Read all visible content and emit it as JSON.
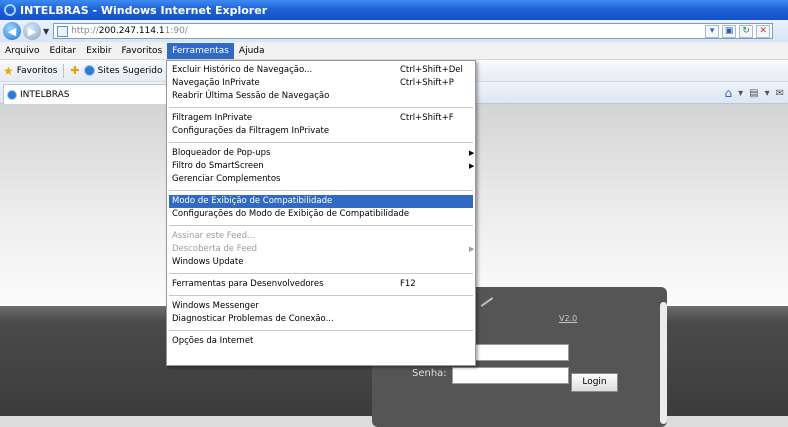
{
  "window": {
    "title": "INTELBRAS - Windows Internet Explorer"
  },
  "address": {
    "proto": "http://",
    "host": "200.247.114.1",
    "rest": "1:90/"
  },
  "menubar": {
    "items": [
      "Arquivo",
      "Editar",
      "Exibir",
      "Favoritos",
      "Ferramentas",
      "Ajuda"
    ],
    "active_index": 4
  },
  "favorites": {
    "label": "Favoritos",
    "suggested": "Sites Sugerido"
  },
  "tab": {
    "title": "INTELBRAS"
  },
  "login": {
    "version": "V2.0",
    "password_label": "Senha:",
    "login_button": "Login"
  },
  "tools_menu": {
    "items": [
      {
        "label": "Excluir Histórico de Navegação...",
        "shortcut": "Ctrl+Shift+Del"
      },
      {
        "label": "Navegação InPrivate",
        "shortcut": "Ctrl+Shift+P"
      },
      {
        "label": "Reabrir Última Sessão de Navegação"
      },
      {
        "label": "Filtragem InPrivate",
        "shortcut": "Ctrl+Shift+F"
      },
      {
        "label": "Configurações da Filtragem InPrivate"
      },
      {
        "label": "Bloqueador de Pop-ups",
        "submenu": true
      },
      {
        "label": "Filtro do SmartScreen",
        "submenu": true
      },
      {
        "label": "Gerenciar Complementos"
      },
      {
        "label": "Modo de Exibição de Compatibilidade",
        "highlighted": true
      },
      {
        "label": "Configurações do Modo de Exibição de Compatibilidade"
      },
      {
        "label": "Assinar este Feed...",
        "disabled": true
      },
      {
        "label": "Descoberta de Feed",
        "disabled": true,
        "submenu": true
      },
      {
        "label": "Windows Update"
      },
      {
        "label": "Ferramentas para Desenvolvedores",
        "shortcut": "F12"
      },
      {
        "label": "Windows Messenger"
      },
      {
        "label": "Diagnosticar Problemas de Conexão..."
      },
      {
        "label": "Opções da Internet"
      }
    ]
  }
}
